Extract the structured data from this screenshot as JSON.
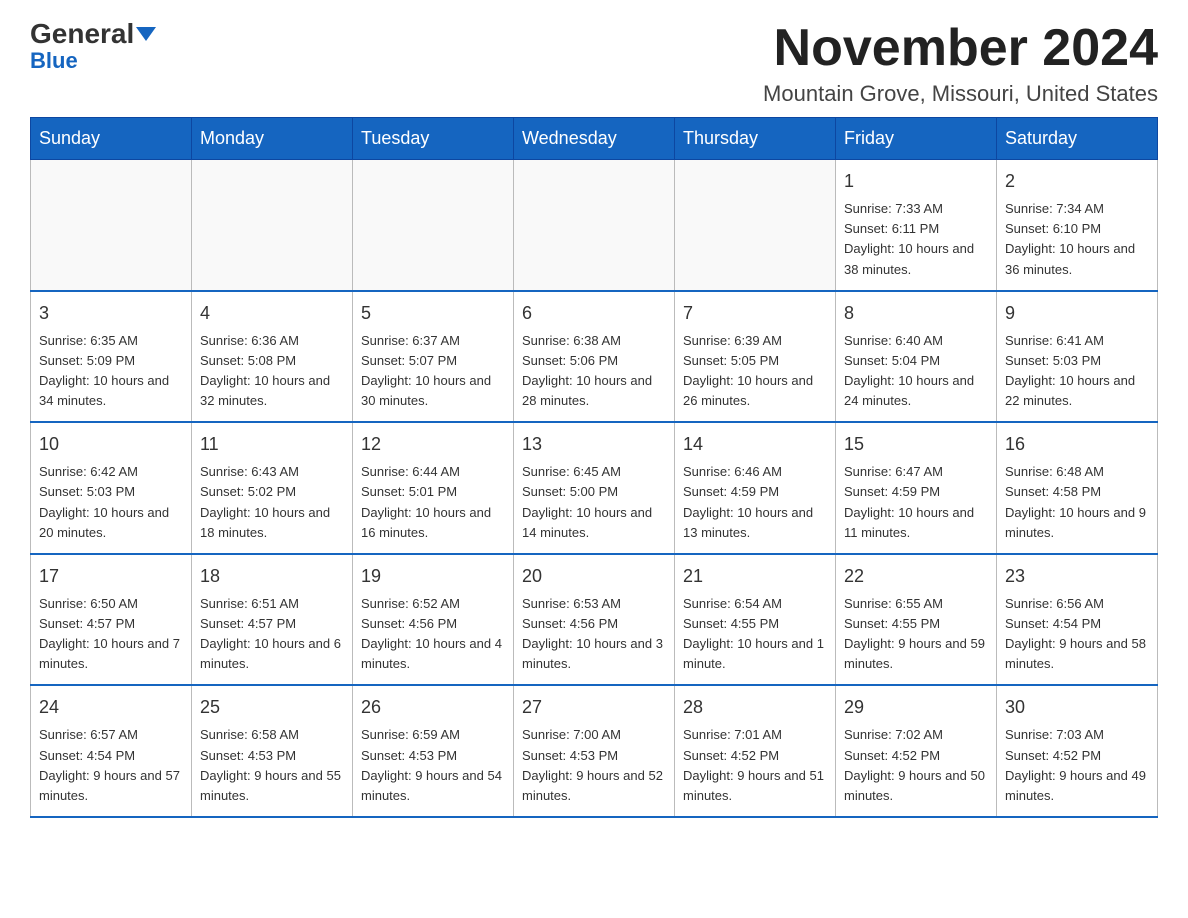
{
  "logo": {
    "general": "General",
    "blue": "Blue"
  },
  "title": "November 2024",
  "location": "Mountain Grove, Missouri, United States",
  "days_of_week": [
    "Sunday",
    "Monday",
    "Tuesday",
    "Wednesday",
    "Thursday",
    "Friday",
    "Saturday"
  ],
  "weeks": [
    [
      {
        "day": "",
        "info": ""
      },
      {
        "day": "",
        "info": ""
      },
      {
        "day": "",
        "info": ""
      },
      {
        "day": "",
        "info": ""
      },
      {
        "day": "",
        "info": ""
      },
      {
        "day": "1",
        "info": "Sunrise: 7:33 AM\nSunset: 6:11 PM\nDaylight: 10 hours and 38 minutes."
      },
      {
        "day": "2",
        "info": "Sunrise: 7:34 AM\nSunset: 6:10 PM\nDaylight: 10 hours and 36 minutes."
      }
    ],
    [
      {
        "day": "3",
        "info": "Sunrise: 6:35 AM\nSunset: 5:09 PM\nDaylight: 10 hours and 34 minutes."
      },
      {
        "day": "4",
        "info": "Sunrise: 6:36 AM\nSunset: 5:08 PM\nDaylight: 10 hours and 32 minutes."
      },
      {
        "day": "5",
        "info": "Sunrise: 6:37 AM\nSunset: 5:07 PM\nDaylight: 10 hours and 30 minutes."
      },
      {
        "day": "6",
        "info": "Sunrise: 6:38 AM\nSunset: 5:06 PM\nDaylight: 10 hours and 28 minutes."
      },
      {
        "day": "7",
        "info": "Sunrise: 6:39 AM\nSunset: 5:05 PM\nDaylight: 10 hours and 26 minutes."
      },
      {
        "day": "8",
        "info": "Sunrise: 6:40 AM\nSunset: 5:04 PM\nDaylight: 10 hours and 24 minutes."
      },
      {
        "day": "9",
        "info": "Sunrise: 6:41 AM\nSunset: 5:03 PM\nDaylight: 10 hours and 22 minutes."
      }
    ],
    [
      {
        "day": "10",
        "info": "Sunrise: 6:42 AM\nSunset: 5:03 PM\nDaylight: 10 hours and 20 minutes."
      },
      {
        "day": "11",
        "info": "Sunrise: 6:43 AM\nSunset: 5:02 PM\nDaylight: 10 hours and 18 minutes."
      },
      {
        "day": "12",
        "info": "Sunrise: 6:44 AM\nSunset: 5:01 PM\nDaylight: 10 hours and 16 minutes."
      },
      {
        "day": "13",
        "info": "Sunrise: 6:45 AM\nSunset: 5:00 PM\nDaylight: 10 hours and 14 minutes."
      },
      {
        "day": "14",
        "info": "Sunrise: 6:46 AM\nSunset: 4:59 PM\nDaylight: 10 hours and 13 minutes."
      },
      {
        "day": "15",
        "info": "Sunrise: 6:47 AM\nSunset: 4:59 PM\nDaylight: 10 hours and 11 minutes."
      },
      {
        "day": "16",
        "info": "Sunrise: 6:48 AM\nSunset: 4:58 PM\nDaylight: 10 hours and 9 minutes."
      }
    ],
    [
      {
        "day": "17",
        "info": "Sunrise: 6:50 AM\nSunset: 4:57 PM\nDaylight: 10 hours and 7 minutes."
      },
      {
        "day": "18",
        "info": "Sunrise: 6:51 AM\nSunset: 4:57 PM\nDaylight: 10 hours and 6 minutes."
      },
      {
        "day": "19",
        "info": "Sunrise: 6:52 AM\nSunset: 4:56 PM\nDaylight: 10 hours and 4 minutes."
      },
      {
        "day": "20",
        "info": "Sunrise: 6:53 AM\nSunset: 4:56 PM\nDaylight: 10 hours and 3 minutes."
      },
      {
        "day": "21",
        "info": "Sunrise: 6:54 AM\nSunset: 4:55 PM\nDaylight: 10 hours and 1 minute."
      },
      {
        "day": "22",
        "info": "Sunrise: 6:55 AM\nSunset: 4:55 PM\nDaylight: 9 hours and 59 minutes."
      },
      {
        "day": "23",
        "info": "Sunrise: 6:56 AM\nSunset: 4:54 PM\nDaylight: 9 hours and 58 minutes."
      }
    ],
    [
      {
        "day": "24",
        "info": "Sunrise: 6:57 AM\nSunset: 4:54 PM\nDaylight: 9 hours and 57 minutes."
      },
      {
        "day": "25",
        "info": "Sunrise: 6:58 AM\nSunset: 4:53 PM\nDaylight: 9 hours and 55 minutes."
      },
      {
        "day": "26",
        "info": "Sunrise: 6:59 AM\nSunset: 4:53 PM\nDaylight: 9 hours and 54 minutes."
      },
      {
        "day": "27",
        "info": "Sunrise: 7:00 AM\nSunset: 4:53 PM\nDaylight: 9 hours and 52 minutes."
      },
      {
        "day": "28",
        "info": "Sunrise: 7:01 AM\nSunset: 4:52 PM\nDaylight: 9 hours and 51 minutes."
      },
      {
        "day": "29",
        "info": "Sunrise: 7:02 AM\nSunset: 4:52 PM\nDaylight: 9 hours and 50 minutes."
      },
      {
        "day": "30",
        "info": "Sunrise: 7:03 AM\nSunset: 4:52 PM\nDaylight: 9 hours and 49 minutes."
      }
    ]
  ]
}
